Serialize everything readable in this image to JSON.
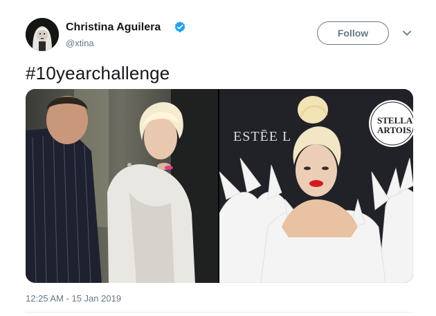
{
  "author": {
    "name": "Christina Aguilera",
    "handle": "@xtina",
    "verified": true,
    "avatar_icon": "avatar-portrait"
  },
  "follow_button": {
    "label": "Follow"
  },
  "menu_icon": "chevron-down-icon",
  "tweet": {
    "text": "#10yearchallenge"
  },
  "media": {
    "photo_left": {
      "icon": "photo-then"
    },
    "photo_right": {
      "icon": "photo-now",
      "sign_text_1": "ESTĒE L",
      "sign_text_2": "STELLA",
      "sign_text_3": "ARTOIS"
    }
  },
  "timestamp": "12:25 AM - 15 Jan 2019",
  "colors": {
    "text": "#14171a",
    "secondary": "#657786",
    "verified_blue": "#1da1f2",
    "divider": "#e6ecf0"
  }
}
